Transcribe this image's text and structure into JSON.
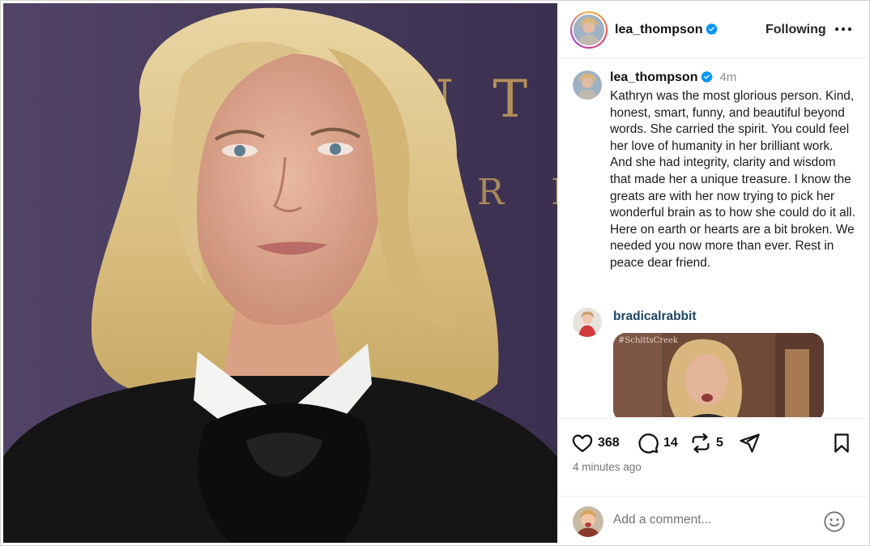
{
  "post": {
    "author": {
      "username": "lea_thompson",
      "verified": true,
      "follow_status": "Following",
      "more_icon": "more-horizontal-icon"
    },
    "caption": {
      "username": "lea_thompson",
      "time": "4m",
      "text": "Kathryn was the most glorious person. Kind, honest, smart, funny, and beautiful beyond words. She carried the spirit. You could feel her love of humanity in her brilliant work. And she had integrity, clarity and wisdom that made her a unique treasure. I know the greats are with her now trying to pick her wonderful brain as to how she could do it all. Here on earth or hearts are a bit broken. We needed you now more than ever. Rest in peace dear friend."
    },
    "comment": {
      "username": "bradicalrabbit",
      "gif_watermark": "#SchittsCreek"
    },
    "photo_backdrop_text": [
      "N T U",
      "R E"
    ],
    "stats": {
      "likes": "368",
      "comments": "14",
      "reposts": "5"
    },
    "timestamp": "4 minutes ago",
    "add_comment": {
      "placeholder": "Add a comment..."
    },
    "icons": {
      "like": "heart-icon",
      "comment": "comment-bubble-icon",
      "repost": "repost-icon",
      "share": "send-icon",
      "save": "bookmark-icon",
      "emoji": "emoji-icon"
    },
    "colors": {
      "verified": "#0095f6",
      "link_user": "#1c4565"
    }
  }
}
